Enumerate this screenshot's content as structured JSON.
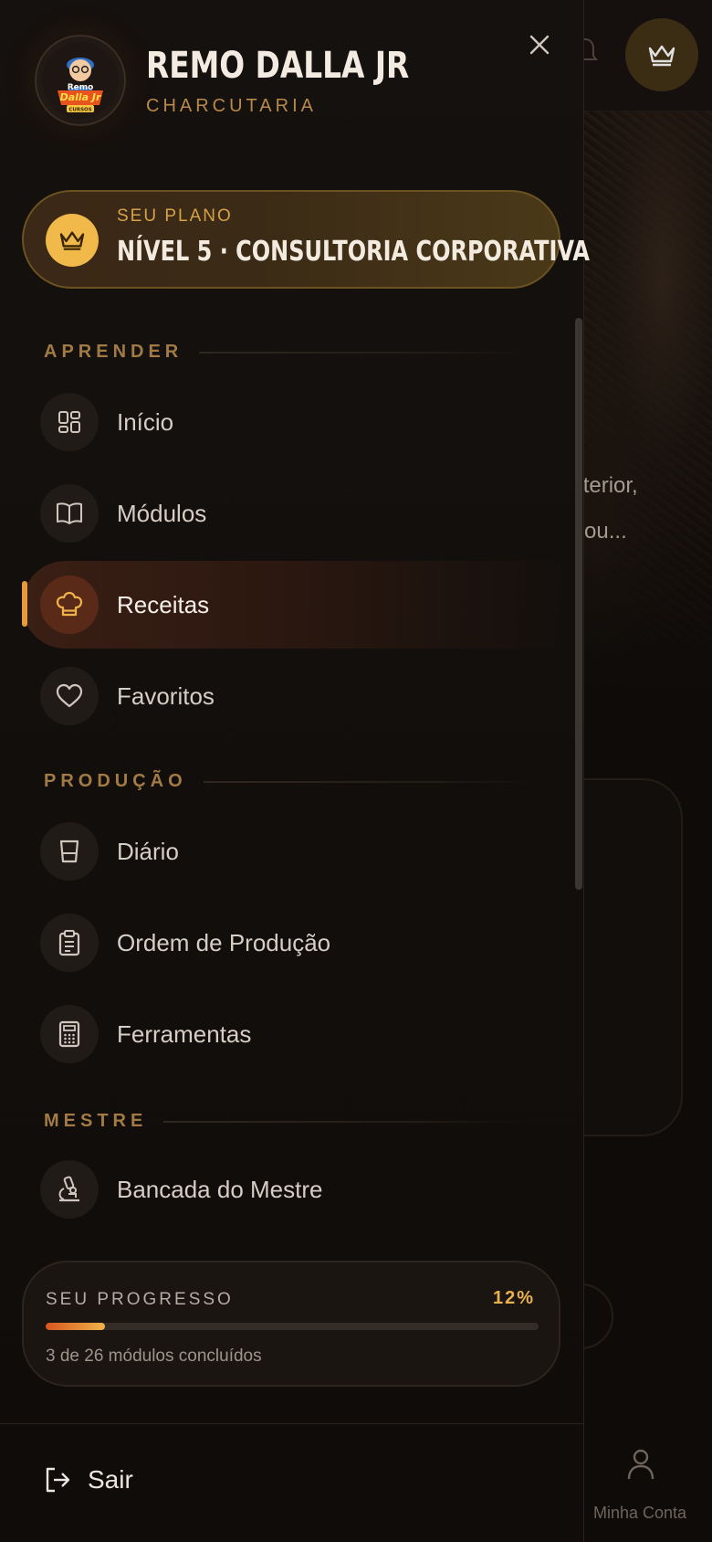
{
  "brand": {
    "name": "REMO DALLA JR",
    "subtitle": "CHARCUTARIA",
    "logo_text": [
      "Remo",
      "Dalla Jr",
      "CURSOS"
    ]
  },
  "plan": {
    "label": "SEU PLANO",
    "name": "NÍVEL 5 · CONSULTORIA CORPORATIVA",
    "icon": "crown-icon"
  },
  "sections": {
    "learn": {
      "title": "APRENDER"
    },
    "production": {
      "title": "PRODUÇÃO"
    },
    "master": {
      "title": "MESTRE"
    }
  },
  "nav": {
    "inicio": {
      "label": "Início",
      "icon": "grid-icon"
    },
    "modulos": {
      "label": "Módulos",
      "icon": "book-icon"
    },
    "receitas": {
      "label": "Receitas",
      "icon": "chef-hat-icon",
      "active": true
    },
    "favoritos": {
      "label": "Favoritos",
      "icon": "heart-icon"
    },
    "diario": {
      "label": "Diário",
      "icon": "cup-icon"
    },
    "ordem": {
      "label": "Ordem de Produção",
      "icon": "clipboard-icon"
    },
    "ferramentas": {
      "label": "Ferramentas",
      "icon": "calculator-icon"
    },
    "bancada": {
      "label": "Bancada do Mestre",
      "icon": "microscope-icon"
    }
  },
  "progress": {
    "label": "SEU PROGRESSO",
    "percent_text": "12%",
    "percent": 12,
    "summary": "3 de 26 módulos concluídos"
  },
  "logout": {
    "label": "Sair"
  },
  "background": {
    "text_line1": "e interior,",
    "text_line2": "net ou...",
    "bottom_nav_label": "Minha Conta"
  },
  "colors": {
    "accent": "#e9b04b",
    "active_bg": "#3a1f14",
    "progress_start": "#d8561e",
    "progress_end": "#f0b34a"
  }
}
